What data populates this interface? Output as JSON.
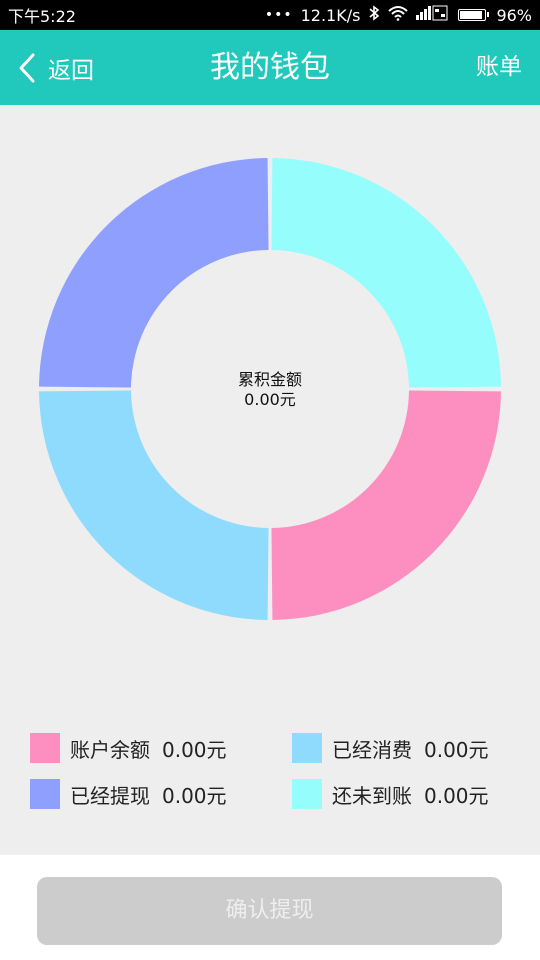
{
  "status_bar": {
    "time": "下午5:22",
    "dots": "•••",
    "net_speed": "12.1K/s",
    "bluetooth_icon": "bluetooth-icon",
    "wifi_icon": "wifi-icon",
    "signal_icon": "signal-icon",
    "battery_percent": "96%"
  },
  "header": {
    "back_label": "返回",
    "title": "我的钱包",
    "bill_label": "账单",
    "background_color": "#21c8bc"
  },
  "chart_data": {
    "type": "pie",
    "style": "donut",
    "center_title": "累积金额",
    "center_value": "0.00元",
    "slices": [
      {
        "name": "还未到账",
        "value": 0.0,
        "color": "#95fdfb"
      },
      {
        "name": "账户余额",
        "value": 0.0,
        "color": "#fd8fc0"
      },
      {
        "name": "已经消费",
        "value": 0.0,
        "color": "#8fdbfd"
      },
      {
        "name": "已经提现",
        "value": 0.0,
        "color": "#8f9ffd"
      }
    ]
  },
  "legend": [
    {
      "label": "账户余额",
      "value": "0.00元",
      "color": "#fd8fc0"
    },
    {
      "label": "已经消费",
      "value": "0.00元",
      "color": "#8fdbfd"
    },
    {
      "label": "已经提现",
      "value": "0.00元",
      "color": "#8f9ffd"
    },
    {
      "label": "还未到账",
      "value": "0.00元",
      "color": "#95fdfb"
    }
  ],
  "confirm_button": {
    "label": "确认提现",
    "state": "disabled"
  }
}
